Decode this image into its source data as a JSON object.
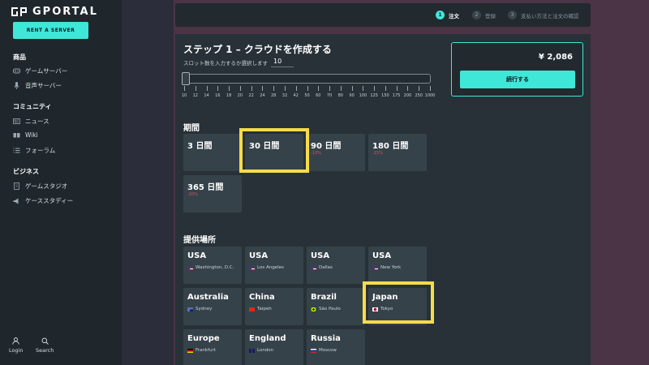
{
  "sidebar": {
    "logo_text": "GPORTAL",
    "rent_button": "RENT A SERVER",
    "sections": [
      {
        "title": "商品",
        "items": [
          {
            "label": "ゲームサーバー",
            "icon": "gamepad-icon"
          },
          {
            "label": "音声サーバー",
            "icon": "microphone-icon"
          }
        ]
      },
      {
        "title": "コミュニティ",
        "items": [
          {
            "label": "ニュース",
            "icon": "newspaper-icon"
          },
          {
            "label": "Wiki",
            "icon": "book-icon"
          },
          {
            "label": "フォーラム",
            "icon": "list-icon"
          }
        ]
      },
      {
        "title": "ビジネス",
        "items": [
          {
            "label": "ゲームスタジオ",
            "icon": "document-icon"
          },
          {
            "label": "ケーススタディー",
            "icon": "megaphone-icon"
          }
        ]
      }
    ],
    "login_label": "Login",
    "search_label": "Search"
  },
  "stepper": {
    "steps": [
      {
        "num": "1",
        "label": "注文",
        "active": true
      },
      {
        "num": "2",
        "label": "登録",
        "active": false
      },
      {
        "num": "3",
        "label": "支払い方法と注文の確認",
        "active": false
      }
    ]
  },
  "main": {
    "title": "ステップ 1 – クラウドを作成する",
    "slot_label": "スロット数を入力するか選択します",
    "slot_value": "10",
    "slider_ticks": [
      "10",
      "12",
      "14",
      "16",
      "18",
      "20",
      "22",
      "24",
      "28",
      "32",
      "42",
      "50",
      "60",
      "70",
      "80",
      "90",
      "100",
      "125",
      "150",
      "175",
      "200",
      "250",
      "1000"
    ],
    "slider_position": 0
  },
  "summary": {
    "price": "¥ 2,086",
    "continue_label": "続行する"
  },
  "duration": {
    "heading": "期間",
    "options": [
      {
        "label": "3 日間",
        "discount": ""
      },
      {
        "label": "30 日間",
        "discount": ""
      },
      {
        "label": "90 日間",
        "discount": "-10%"
      },
      {
        "label": "180 日間",
        "discount": "-15%"
      },
      {
        "label": "365 日間",
        "discount": "-20%"
      }
    ]
  },
  "locations": {
    "heading": "提供場所",
    "options": [
      {
        "country": "USA",
        "city": "Washington, D.C.",
        "flag": "us"
      },
      {
        "country": "USA",
        "city": "Los Angeles",
        "flag": "us"
      },
      {
        "country": "USA",
        "city": "Dallas",
        "flag": "us"
      },
      {
        "country": "USA",
        "city": "New York",
        "flag": "us"
      },
      {
        "country": "Australia",
        "city": "Sydney",
        "flag": "au"
      },
      {
        "country": "China",
        "city": "Taipeh",
        "flag": "cn"
      },
      {
        "country": "Brazil",
        "city": "São Paulo",
        "flag": "br"
      },
      {
        "country": "Japan",
        "city": "Tokyo",
        "flag": "jp"
      },
      {
        "country": "Europe",
        "city": "Frankfurt",
        "flag": "de"
      },
      {
        "country": "England",
        "city": "London",
        "flag": "gb"
      },
      {
        "country": "Russia",
        "city": "Moscow",
        "flag": "ru"
      }
    ]
  },
  "colors": {
    "accent": "#3ee7d8",
    "highlight": "#f7dc4a",
    "discount": "#d0565c"
  }
}
